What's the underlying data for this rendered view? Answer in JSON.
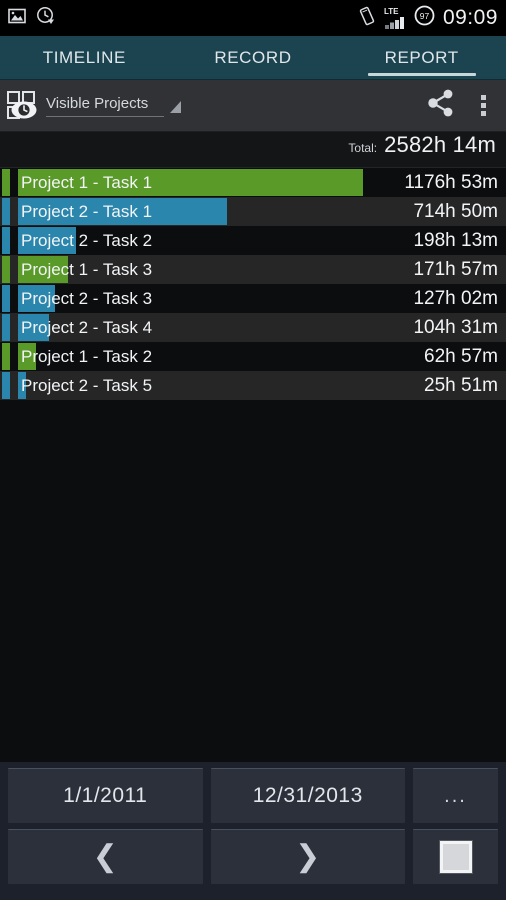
{
  "status_bar": {
    "icons_left": [
      "image-icon",
      "clock-arrow-icon"
    ],
    "icons_right": [
      "vibrate-icon",
      "lte-signal-icon",
      "battery-icon"
    ],
    "lte_label": "LTE",
    "battery_level": "97",
    "time": "09:09"
  },
  "tabs": [
    {
      "label": "TIMELINE",
      "active": false
    },
    {
      "label": "RECORD",
      "active": false
    },
    {
      "label": "REPORT",
      "active": true
    }
  ],
  "action_bar": {
    "app_icon": "projects-eye-icon",
    "spinner_value": "Visible Projects",
    "spinner_icon": "dropdown-triangle-icon",
    "share_icon": "share-icon",
    "overflow_icon": "overflow-menu-icon"
  },
  "summary": {
    "total_label": "Total:",
    "total_value": "2582h 14m"
  },
  "colors": {
    "project_1": "#5a9a28",
    "project_2": "#2b86ad",
    "tab_bar": "#1b4350",
    "action_bar": "#303236",
    "row_dark": "#0c0d0f",
    "row_light": "#262626",
    "bottom_panel": "#1c212b",
    "button": "#2b303a"
  },
  "chart_data": {
    "type": "bar",
    "title": "Visible Projects",
    "xlabel": "",
    "ylabel": "",
    "unit": "hours",
    "total_label": "Total:",
    "total": "2582h 14m",
    "total_hours": 2582.23,
    "max_value": 1176.88,
    "orientation": "horizontal",
    "grid": false,
    "legend": "none",
    "categories": [
      "Project 1 - Task 1",
      "Project 2 - Task 1",
      "Project 2 - Task 2",
      "Project 1 - Task 3",
      "Project 2 - Task 3",
      "Project 2 - Task 4",
      "Project 1 - Task 2",
      "Project 2 - Task 5"
    ],
    "values": [
      1176.88,
      714.83,
      198.22,
      171.95,
      127.03,
      104.52,
      62.95,
      25.85
    ],
    "value_labels": [
      "1176h 53m",
      "714h 50m",
      "198h 13m",
      "171h 57m",
      "127h 02m",
      "104h 31m",
      "62h 57m",
      "25h 51m"
    ],
    "series_colors": [
      "#5a9a28",
      "#2b86ad",
      "#2b86ad",
      "#5a9a28",
      "#2b86ad",
      "#2b86ad",
      "#5a9a28",
      "#2b86ad"
    ]
  },
  "rows": [
    {
      "name": "Project 1 - Task 1",
      "duration": "1176h 53m",
      "pct": 100.0,
      "color": "#5a9a28",
      "alt": false
    },
    {
      "name": "Project 2 - Task 1",
      "duration": "714h 50m",
      "pct": 60.7,
      "color": "#2b86ad",
      "alt": true
    },
    {
      "name": "Project 2 - Task 2",
      "duration": "198h 13m",
      "pct": 16.8,
      "color": "#2b86ad",
      "alt": false
    },
    {
      "name": "Project 1 - Task 3",
      "duration": "171h 57m",
      "pct": 14.6,
      "color": "#5a9a28",
      "alt": true
    },
    {
      "name": "Project 2 - Task 3",
      "duration": "127h 02m",
      "pct": 10.8,
      "color": "#2b86ad",
      "alt": false
    },
    {
      "name": "Project 2 - Task 4",
      "duration": "104h 31m",
      "pct": 8.9,
      "color": "#2b86ad",
      "alt": true
    },
    {
      "name": "Project 1 - Task 2",
      "duration": "62h 57m",
      "pct": 5.3,
      "color": "#5a9a28",
      "alt": false
    },
    {
      "name": "Project 2 - Task 5",
      "duration": "25h 51m",
      "pct": 2.2,
      "color": "#2b86ad",
      "alt": true
    }
  ],
  "bottom": {
    "start_date": "1/1/2011",
    "end_date": "12/31/2013",
    "more_label": "...",
    "prev_icon": "chevron-left-icon",
    "next_icon": "chevron-right-icon",
    "stop_icon": "stop-square-icon"
  }
}
